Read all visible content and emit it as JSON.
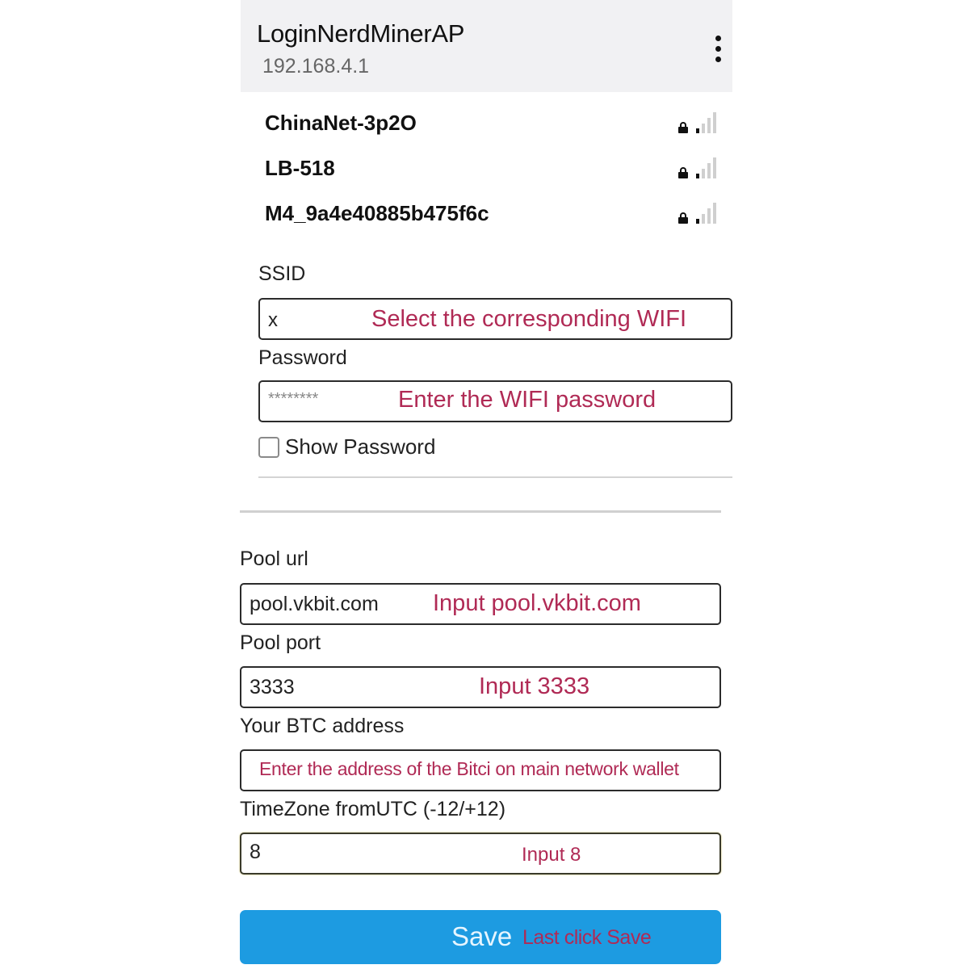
{
  "header": {
    "title": "LoginNerdMinerAP",
    "subtitle": "192.168.4.1",
    "menu_icon": "kebab-menu-icon"
  },
  "wifi_networks": [
    {
      "ssid": "ChinaNet-3p2O",
      "secured": true,
      "signal_bars": 1,
      "signal_max": 4
    },
    {
      "ssid": "LB-518",
      "secured": true,
      "signal_bars": 1,
      "signal_max": 4
    },
    {
      "ssid": "M4_9a4e40885b475f6c",
      "secured": true,
      "signal_bars": 1,
      "signal_max": 4
    }
  ],
  "wifi_form": {
    "ssid_label": "SSID",
    "ssid_value": "x",
    "ssid_hint": "Select the corresponding WIFI",
    "password_label": "Password",
    "password_value": "********",
    "password_hint": "Enter the WIFI password",
    "show_password_label": "Show Password",
    "show_password_checked": false
  },
  "miner_form": {
    "pool_url_label": "Pool url",
    "pool_url_value": "pool.vkbit.com",
    "pool_url_hint": "Input pool.vkbit.com",
    "pool_port_label": "Pool port",
    "pool_port_value": "3333",
    "pool_port_hint": "Input 3333",
    "btc_address_label": "Your BTC address",
    "btc_address_value": "",
    "btc_address_hint": "Enter the address of the Bitci on main network wallet",
    "timezone_label": "TimeZone fromUTC (-12/+12)",
    "timezone_value": "8",
    "timezone_hint": "Input 8"
  },
  "save_button": {
    "label": "Save",
    "hint": "Last click Save"
  },
  "colors": {
    "annotation": "#b02a55",
    "save_button": "#1d9be1",
    "header_bg": "#f1f1f3"
  }
}
